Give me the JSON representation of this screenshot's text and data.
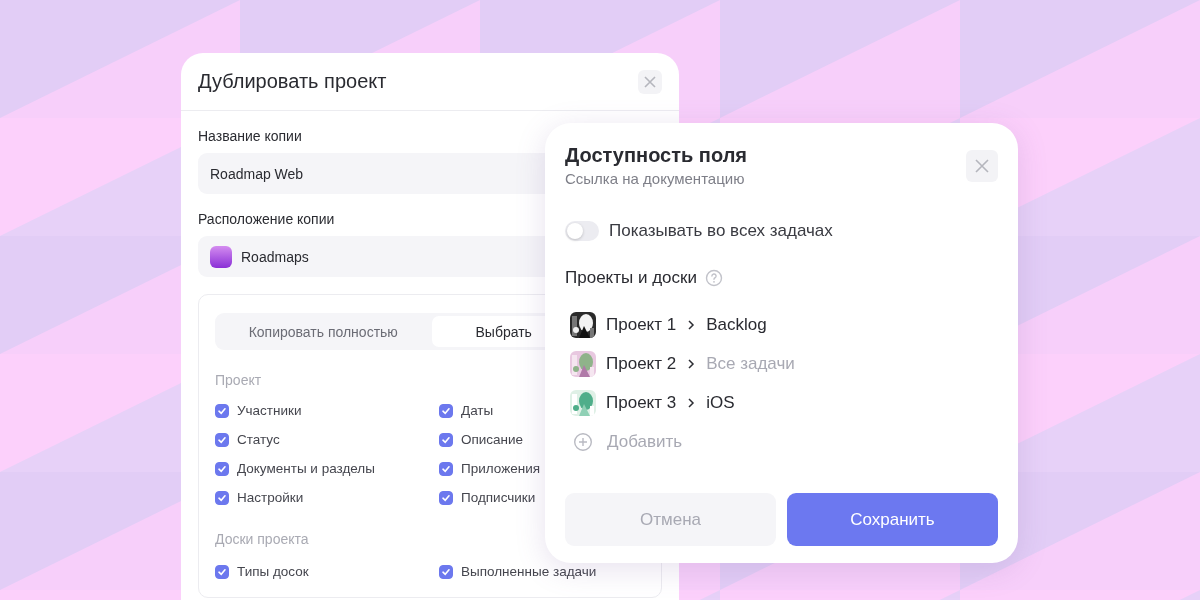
{
  "duplicate_dialog": {
    "title": "Дублировать проект",
    "name_label": "Название копии",
    "name_value": "Roadmap Web",
    "location_label": "Расположение копии",
    "location_value": "Roadmaps",
    "tabs": [
      {
        "label": "Копировать полностью",
        "selected": false
      },
      {
        "label": "Выбрать",
        "selected": true
      }
    ],
    "sections": [
      {
        "title": "Проект",
        "options": [
          {
            "label": "Участники",
            "checked": true
          },
          {
            "label": "Даты",
            "checked": true
          },
          {
            "label": "Статус",
            "checked": true
          },
          {
            "label": "Описание",
            "checked": true
          },
          {
            "label": "Документы и разделы",
            "checked": true
          },
          {
            "label": "Приложения",
            "checked": true
          },
          {
            "label": "Настройки",
            "checked": true
          },
          {
            "label": "Подписчики",
            "checked": true
          }
        ]
      },
      {
        "title": "Доски проекта",
        "options": [
          {
            "label": "Типы досок",
            "checked": true
          },
          {
            "label": "Выполненные задачи",
            "checked": true
          }
        ]
      }
    ]
  },
  "field_dialog": {
    "title": "Доступность поля",
    "subtitle": "Ссылка на документацию",
    "toggle": {
      "label": "Показывать во всех задачах",
      "on": false
    },
    "projects_heading": "Проекты и доски",
    "projects": [
      {
        "name": "Проект 1",
        "board": "Backlog",
        "is_default": false,
        "kind": "picture"
      },
      {
        "name": "Проект 2",
        "board": "Все задачи",
        "is_default": true,
        "kind": "picture"
      },
      {
        "name": "Проект 3",
        "board": "iOS",
        "is_default": false,
        "kind": "picture"
      }
    ],
    "add_label": "Добавить",
    "buttons": [
      {
        "label": "Отмена",
        "kind": "secondary"
      },
      {
        "label": "Сохранить",
        "kind": "primary"
      }
    ]
  }
}
